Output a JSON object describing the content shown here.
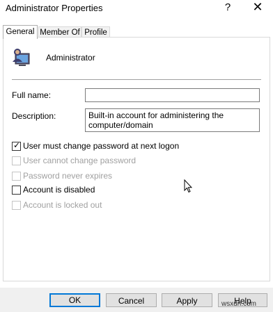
{
  "window": {
    "title": "Administrator Properties",
    "help_glyph": "?",
    "close_glyph": "✕"
  },
  "tabs": [
    {
      "label": "General",
      "active": true
    },
    {
      "label": "Member Of",
      "active": false
    },
    {
      "label": "Profile",
      "active": false
    }
  ],
  "user": {
    "name": "Administrator",
    "icon": "user-monitor-icon"
  },
  "fields": {
    "full_name": {
      "label": "Full name:",
      "value": ""
    },
    "description": {
      "label": "Description:",
      "value": "Built-in account for administering the computer/domain"
    }
  },
  "checkboxes": [
    {
      "label": "User must change password at next logon",
      "checked": true,
      "enabled": true
    },
    {
      "label": "User cannot change password",
      "checked": false,
      "enabled": false
    },
    {
      "label": "Password never expires",
      "checked": false,
      "enabled": false
    },
    {
      "label": "Account is disabled",
      "checked": false,
      "enabled": true
    },
    {
      "label": "Account is locked out",
      "checked": false,
      "enabled": false
    }
  ],
  "buttons": {
    "ok": "OK",
    "cancel": "Cancel",
    "apply": "Apply",
    "help": "Help"
  },
  "watermark": "wsxdn.com",
  "colors": {
    "accent": "#0078d7",
    "disabled_text": "#a0a0a0",
    "footer_bg": "#f0f0f0"
  }
}
